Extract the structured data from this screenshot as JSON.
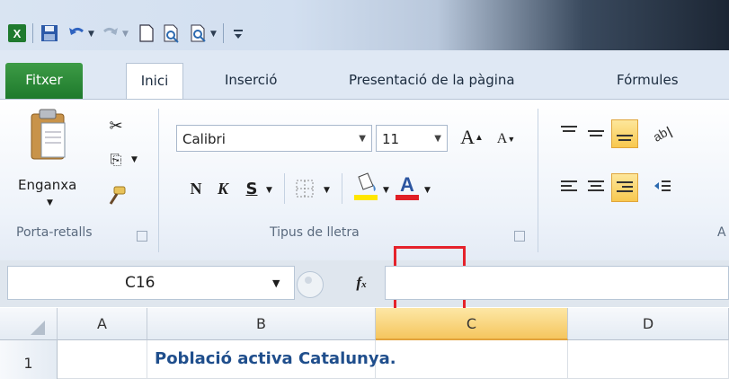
{
  "quick_access": {
    "icons": [
      "excel-logo-icon",
      "save-icon",
      "undo-icon",
      "redo-icon",
      "new-document-icon",
      "print-preview-icon",
      "quick-print-icon",
      "customize-icon"
    ]
  },
  "tabs": [
    {
      "label": "Fitxer"
    },
    {
      "label": "Inici"
    },
    {
      "label": "Inserció"
    },
    {
      "label": "Presentació de la pàgina"
    },
    {
      "label": "Fórmules"
    }
  ],
  "ribbon": {
    "clipboard": {
      "paste_label": "Enganxa",
      "group_label": "Porta-retalls"
    },
    "font": {
      "font_name": "Calibri",
      "font_size": "11",
      "bold": "N",
      "italic": "K",
      "underline": "S",
      "group_label": "Tipus de lletra"
    },
    "alignment": {
      "group_label": "A"
    }
  },
  "formula_bar": {
    "name_box": "C16",
    "fx": "fx",
    "formula": ""
  },
  "grid": {
    "columns": [
      "A",
      "B",
      "C",
      "D"
    ],
    "rows": [
      "1"
    ],
    "cells": {
      "B1": "Població activa Catalunya."
    },
    "selected_column": "C"
  },
  "colors": {
    "accent": "#f5c65e",
    "file_tab": "#2a8a37",
    "highlight_box": "#e5222b",
    "font_color_bar": "#e01f26",
    "fill_color_bar": "#ffe600"
  }
}
